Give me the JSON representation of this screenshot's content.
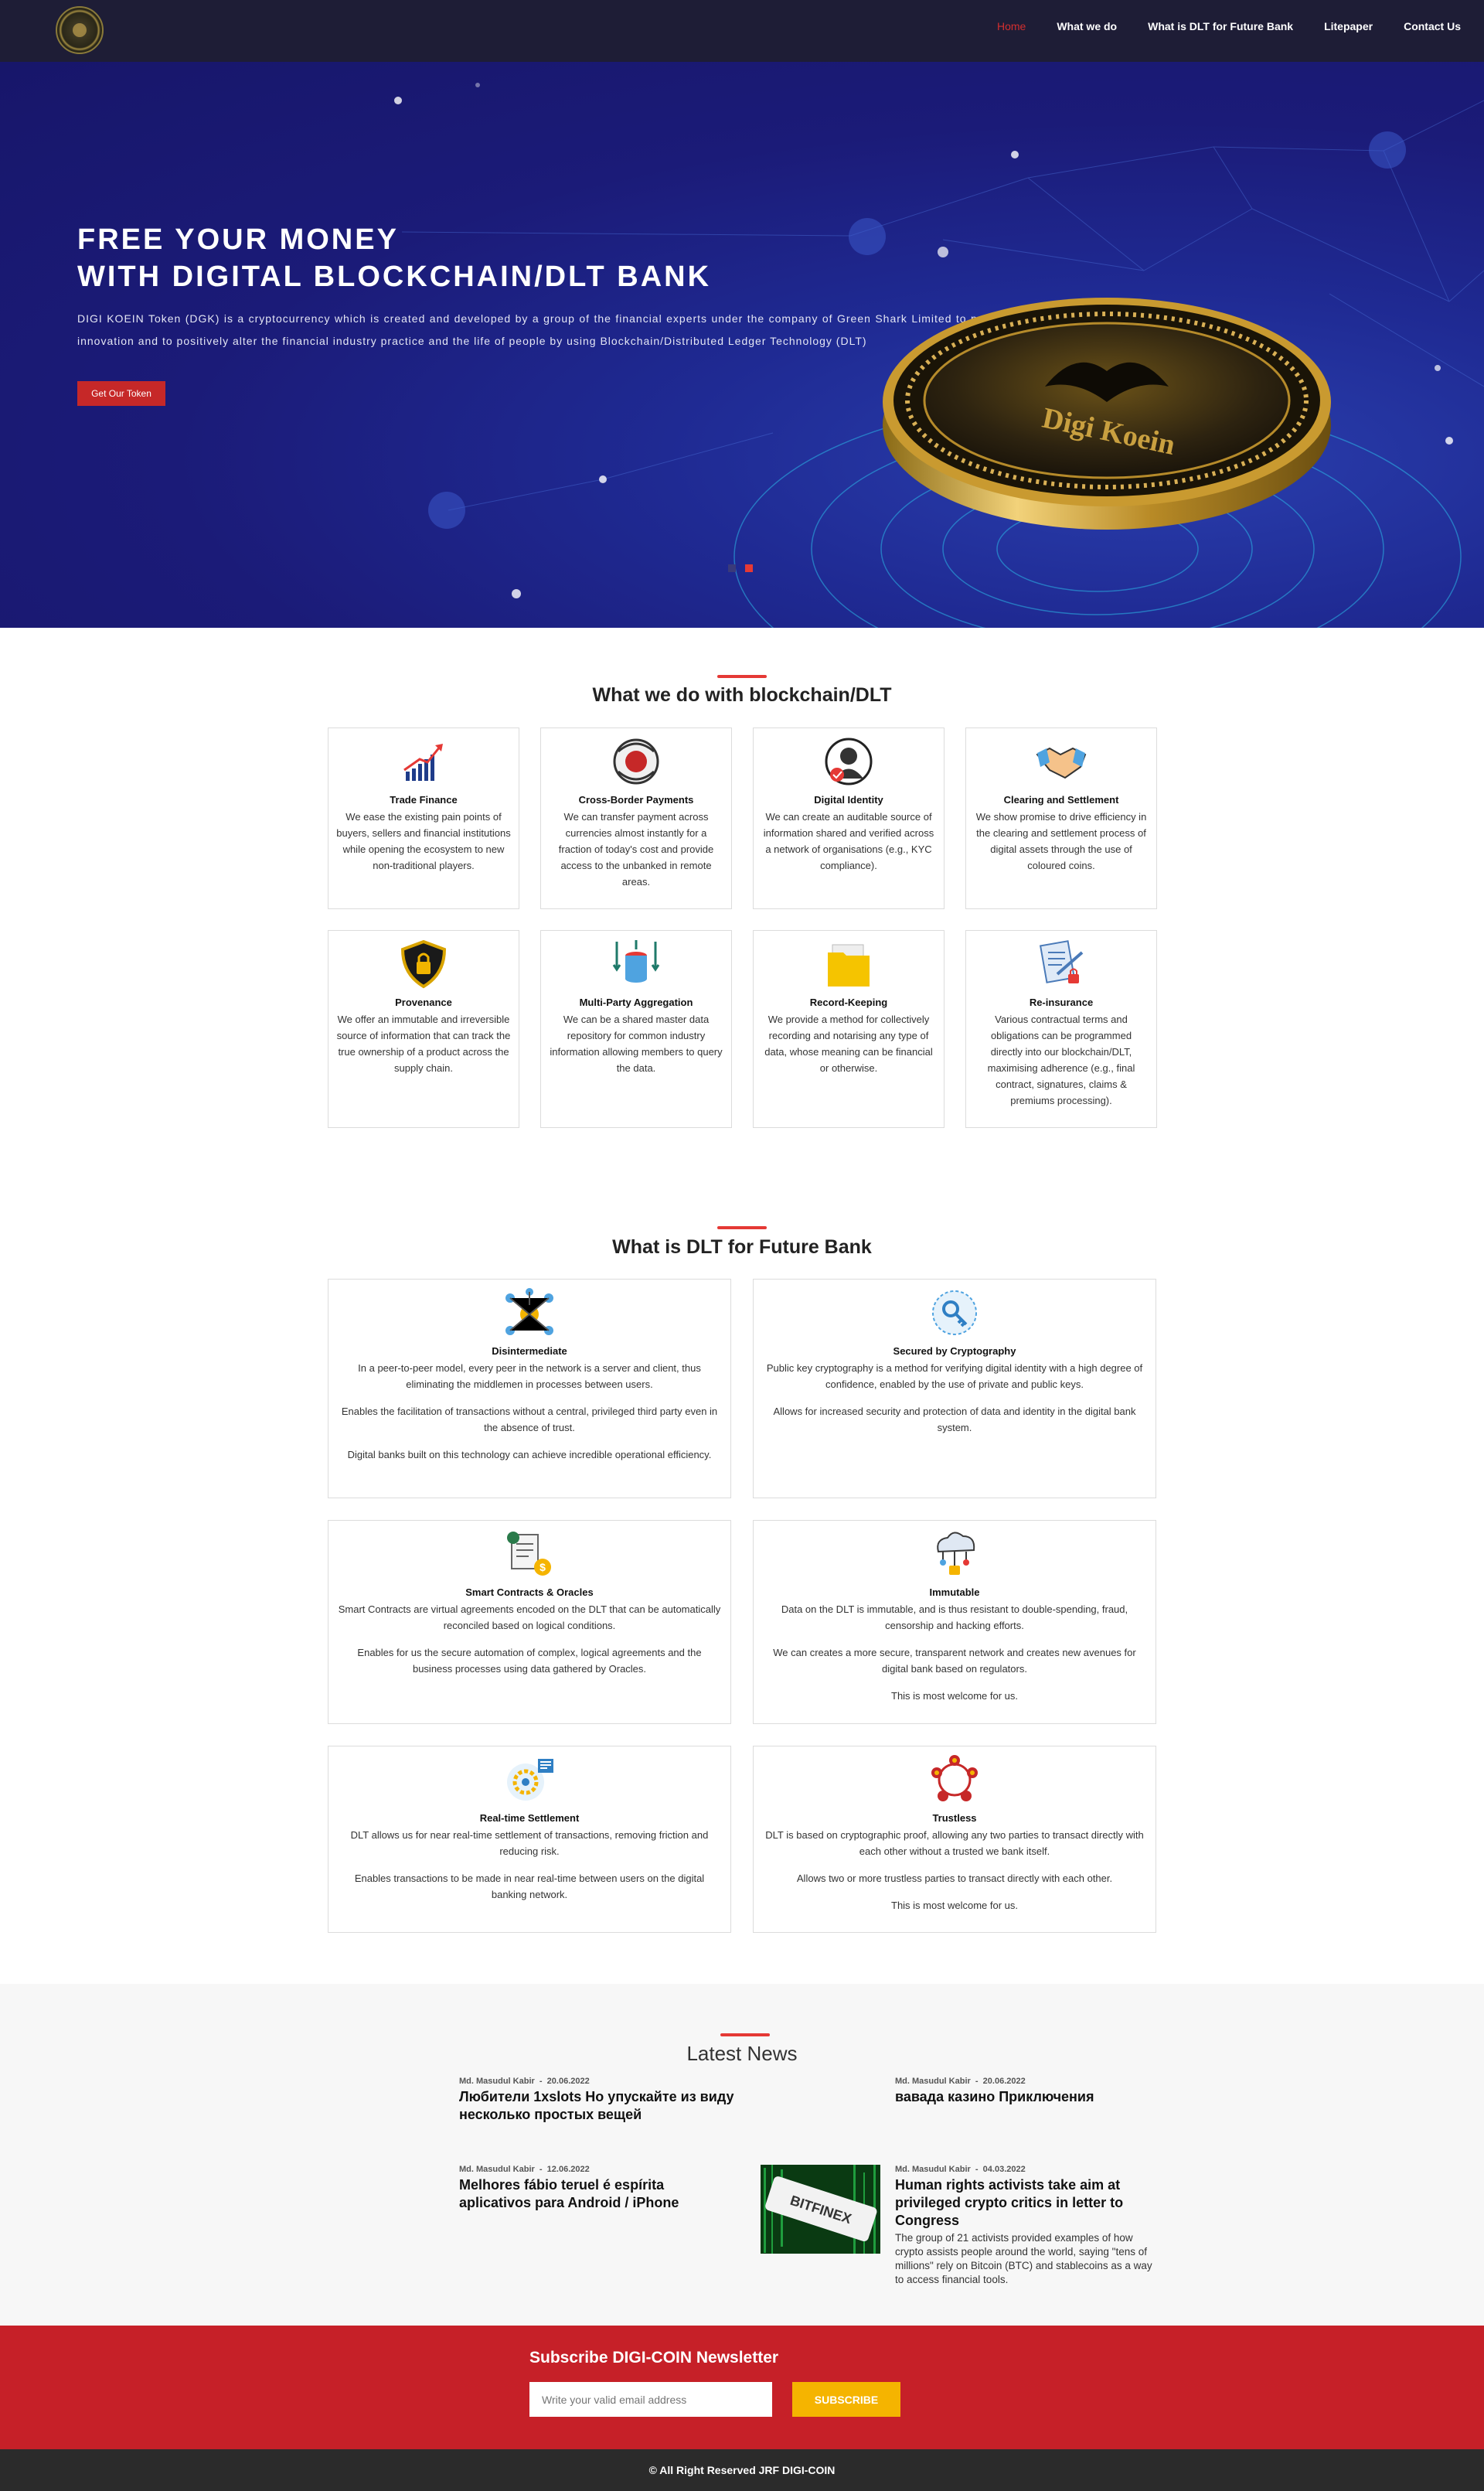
{
  "nav": {
    "items": [
      "Home",
      "What we do",
      "What is DLT for Future Bank",
      "Litepaper",
      "Contact Us"
    ]
  },
  "hero": {
    "title_line1": "FREE YOUR MONEY",
    "title_line2": "WITH DIGITAL BLOCKCHAIN/DLT BANK",
    "description": "DIGI KOEIN Token (DGK) is a cryptocurrency which is created and developed by a group of the financial experts under the company of Green Shark Limited to prompt a technological innovation and to positively alter the financial industry practice and the life of people by using Blockchain/Distributed Ledger Technology (DLT)",
    "button": "Get Our Token",
    "coin_text": "Digi Koein"
  },
  "what_we_do": {
    "title": "What we do with blockchain/DLT",
    "cards": [
      {
        "icon": "bar-chart-growth-icon",
        "title": "Trade Finance",
        "text": "We ease the existing pain points of buyers, sellers and financial institutions while opening the ecosystem to new non-traditional players."
      },
      {
        "icon": "payment-transfer-icon",
        "title": "Cross-Border Payments",
        "text": "We can transfer payment across currencies almost instantly for a fraction of today's cost and provide access to the unbanked in remote areas."
      },
      {
        "icon": "identity-verified-icon",
        "title": "Digital Identity",
        "text": "We can create an auditable source of information shared and verified across a network of organisations (e.g., KYC compliance)."
      },
      {
        "icon": "handshake-icon",
        "title": "Clearing and Settlement",
        "text": "We show promise to drive efficiency in the clearing and settlement process of digital assets through the use of coloured coins."
      },
      {
        "icon": "shield-lock-icon",
        "title": "Provenance",
        "text": "We offer an immutable and irreversible source of information that can track the true ownership of a product across the supply chain."
      },
      {
        "icon": "database-arrows-icon",
        "title": "Multi-Party Aggregation",
        "text": "We can be a shared master data repository for common industry information allowing members to query the data."
      },
      {
        "icon": "folder-icon",
        "title": "Record-Keeping",
        "text": "We provide a method for collectively recording and notarising any type of data, whose meaning can be financial or otherwise."
      },
      {
        "icon": "contract-lock-icon",
        "title": "Re-insurance",
        "text": "Various contractual terms and obligations can be programmed directly into our blockchain/DLT, maximising adherence (e.g., final contract, signatures, claims & premiums processing)."
      }
    ]
  },
  "dlt": {
    "title": "What is DLT for Future Bank",
    "cards": [
      {
        "icon": "network-nodes-icon",
        "title": "Disintermediate",
        "paragraphs": [
          "In a peer-to-peer model, every peer in the network is a server and client, thus eliminating the middlemen in processes between users.",
          "Enables the facilitation of transactions without a central, privileged third party even in the absence of trust.",
          "Digital banks built on this technology can achieve incredible operational efficiency."
        ]
      },
      {
        "icon": "crypto-key-icon",
        "title": "Secured by Cryptography",
        "paragraphs": [
          "Public key cryptography is a method for verifying digital identity with a high degree of confidence, enabled by the use of private and public keys.",
          "Allows for increased security and protection of data and identity in the digital bank system."
        ]
      },
      {
        "icon": "smart-contract-icon",
        "title": "Smart Contracts & Oracles",
        "paragraphs": [
          "Smart Contracts are virtual agreements encoded on the DLT that can be automatically reconciled based on logical conditions.",
          "Enables for us the secure automation of complex, logical agreements and the business processes using data gathered by Oracles."
        ]
      },
      {
        "icon": "cloud-lock-icon",
        "title": "Immutable",
        "paragraphs": [
          "Data on the DLT is immutable, and is thus resistant to double-spending, fraud, censorship and hacking efforts.",
          "We can creates a more secure, transparent network and creates new avenues for digital bank based on regulators.",
          "This is most welcome for us."
        ]
      },
      {
        "icon": "realtime-gear-icon",
        "title": "Real-time Settlement",
        "paragraphs": [
          "DLT allows us for near real-time settlement of transactions, removing friction and reducing risk.",
          "Enables transactions to be made in near real-time between users on the digital banking network."
        ]
      },
      {
        "icon": "trust-circle-icon",
        "title": "Trustless",
        "paragraphs": [
          "DLT is based on cryptographic proof, allowing any two parties to transact directly with each other without a trusted we bank itself.",
          "Allows two or more trustless parties to transact directly with each other.",
          "This is most welcome for us."
        ]
      }
    ]
  },
  "news": {
    "title": "Latest News",
    "items": [
      {
        "author": "Md. Masudul Kabir",
        "date": "20.06.2022",
        "headline": "Любители 1xslots Но упускайте из виду несколько простых вещей",
        "excerpt": ""
      },
      {
        "author": "Md. Masudul Kabir",
        "date": "20.06.2022",
        "headline": "вавада казино Приключения",
        "excerpt": ""
      },
      {
        "author": "Md. Masudul Kabir",
        "date": "12.06.2022",
        "headline": "Melhores fábio teruel é espírita aplicativos para Android / iPhone",
        "excerpt": ""
      },
      {
        "author": "Md. Masudul Kabir",
        "date": "04.03.2022",
        "headline": "Human rights activists take aim at privileged crypto critics in letter to Congress",
        "excerpt": "The group of 21 activists provided examples of how crypto assists people around the world, saying \"tens of millions\" rely on Bitcoin (BTC) and stablecoins as a way to access financial tools.",
        "thumb_text": "BITFINEX"
      }
    ]
  },
  "newsletter": {
    "title": "Subscribe DIGI-COIN Newsletter",
    "placeholder": "Write your valid email address",
    "button": "SUBSCRIBE"
  },
  "footer": {
    "text": "© All Right Reserved JRF DIGI-COIN"
  },
  "colors": {
    "accent": "#e53935",
    "nav_bg": "#1e1d36",
    "hero_bg": "#1b1b78",
    "newsletter_bg": "#c62028",
    "subscribe_btn": "#f5b400"
  }
}
